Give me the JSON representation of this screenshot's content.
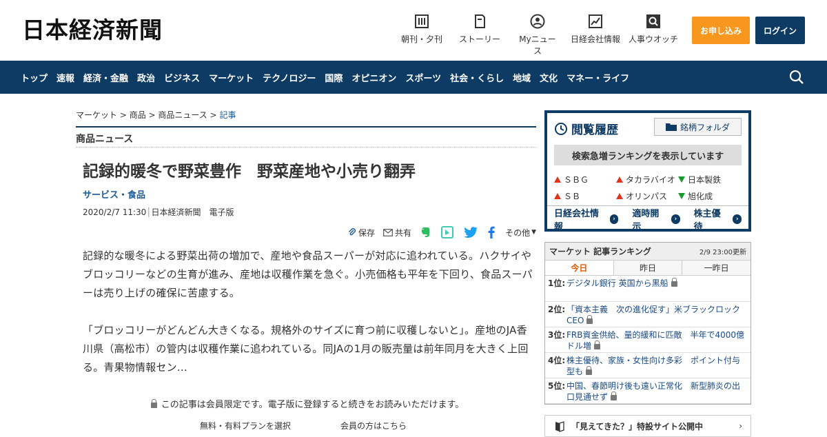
{
  "header": {
    "logo": "日本経済新聞",
    "icons": [
      {
        "label": "朝刊・夕刊",
        "icon": "newspaper-icon"
      },
      {
        "label": "ストーリー",
        "icon": "book-icon"
      },
      {
        "label": "Myニュース",
        "icon": "person-icon"
      },
      {
        "label": "日経会社情報",
        "icon": "chart-icon"
      },
      {
        "label": "人事ウオッチ",
        "icon": "magnifier-icon"
      }
    ],
    "apply_label": "お申し込み",
    "login_label": "ログイン"
  },
  "nav": {
    "items": [
      "トップ",
      "速報",
      "経済・金融",
      "政治",
      "ビジネス",
      "マーケット",
      "テクノロジー",
      "国際",
      "オピニオン",
      "スポーツ",
      "社会・くらし",
      "地域",
      "文化",
      "マネー・ライフ"
    ]
  },
  "breadcrumb": {
    "items": [
      "マーケット",
      "商品",
      "商品ニュース"
    ],
    "current": "記事",
    "sep": " > "
  },
  "section": "商品ニュース",
  "article": {
    "title": "記録的暖冬で野菜豊作　野菜産地や小売り翻弄",
    "category": "サービス・食品",
    "date": "2020/2/7 11:30",
    "source": "日本経済新聞　電子版",
    "share": {
      "save": "保存",
      "share": "共有",
      "more": "その他"
    },
    "para1": "記録的な暖冬による野菜出荷の増加で、産地や食品スーパーが対応に追われている。ハクサイやブロッコリーなどの生育が進み、産地は収穫作業を急ぐ。小売価格も平年を下回り、食品スーパーは売り上げの確保に苦慮する。",
    "para2": "「ブロッコリーがどんどん大きくなる。規格外のサイズに育つ前に収穫しないと」。産地のJA香川県（高松市）の管内は収穫作業に追われている。同JAの1月の販売量は前年同月を大きく上回る。青果物情報セン…",
    "members_note": "この記事は会員限定です。電子版に登録すると続きをお読みいただけます。",
    "plan_link": "無料・有料プランを選択",
    "member_link": "会員の方はこちら"
  },
  "history": {
    "title": "閲覧履歴",
    "folder": "銘柄フォルダ",
    "ranking_notice": "検索急増ランキングを表示しています",
    "stocks": [
      {
        "name": "ＳＢＧ",
        "dir": "up"
      },
      {
        "name": "タカラバイオ",
        "dir": "up"
      },
      {
        "name": "日本製鉄",
        "dir": "down"
      },
      {
        "name": "ＳＢ",
        "dir": "up"
      },
      {
        "name": "オリンパス",
        "dir": "up"
      },
      {
        "name": "旭化成",
        "dir": "down"
      }
    ],
    "links": [
      "日経会社情報",
      "適時開示",
      "株主優待"
    ]
  },
  "ranking": {
    "title": "マーケット 記事ランキング",
    "updated": "2/9 23:00更新",
    "tabs": [
      "今日",
      "昨日",
      "一昨日"
    ],
    "items": [
      {
        "rank": "1位:",
        "text": "デジタル銀行 英国から黒船"
      },
      {
        "rank": "2位:",
        "text": "「資本主義　次の進化促す」米ブラックロックCEO"
      },
      {
        "rank": "3位:",
        "text": "FRB資金供給、量的緩和に匹敵　半年で4000億ドル増"
      },
      {
        "rank": "4位:",
        "text": "株主優待、家族・女性向け多彩　ポイント付与型も"
      },
      {
        "rank": "5位:",
        "text": "中国、春節明け後も遠い正常化　新型肺炎の出口見通せず"
      }
    ]
  },
  "promo": {
    "text": "「見えてきた？」特設サイト公開中"
  },
  "colors": {
    "navy": "#0e3b64",
    "orange": "#f7971e",
    "link": "#1a5a96"
  }
}
